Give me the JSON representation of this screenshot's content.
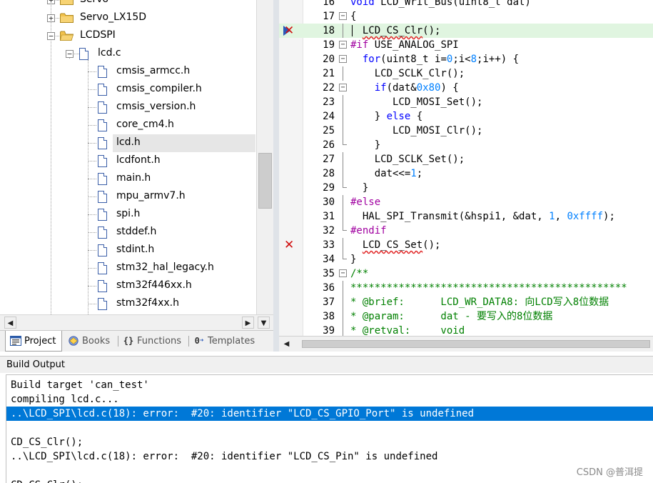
{
  "project_tree": {
    "items": [
      {
        "label": "Servo",
        "kind": "folder",
        "expander": "+"
      },
      {
        "label": "Servo_LX15D",
        "kind": "folder",
        "expander": "+"
      },
      {
        "label": "LCDSPI",
        "kind": "folder",
        "expander": "−"
      },
      {
        "label": "lcd.c",
        "kind": "file",
        "expander": "−"
      },
      {
        "label": "cmsis_armcc.h",
        "kind": "header"
      },
      {
        "label": "cmsis_compiler.h",
        "kind": "header"
      },
      {
        "label": "cmsis_version.h",
        "kind": "header"
      },
      {
        "label": "core_cm4.h",
        "kind": "header"
      },
      {
        "label": "lcd.h",
        "kind": "header",
        "selected": true
      },
      {
        "label": "lcdfont.h",
        "kind": "header"
      },
      {
        "label": "main.h",
        "kind": "header"
      },
      {
        "label": "mpu_armv7.h",
        "kind": "header"
      },
      {
        "label": "spi.h",
        "kind": "header"
      },
      {
        "label": "stddef.h",
        "kind": "header"
      },
      {
        "label": "stdint.h",
        "kind": "header"
      },
      {
        "label": "stm32_hal_legacy.h",
        "kind": "header"
      },
      {
        "label": "stm32f446xx.h",
        "kind": "header"
      },
      {
        "label": "stm32f4xx.h",
        "kind": "header"
      }
    ]
  },
  "scrollbar": {
    "left": "◀",
    "right": "▶",
    "down": "▼"
  },
  "tabs": [
    {
      "label": "Project",
      "icon": "project-icon",
      "active": true
    },
    {
      "label": "Books",
      "icon": "books-icon"
    },
    {
      "label": "Functions",
      "icon": "functions-icon",
      "glyph": "{}"
    },
    {
      "label": "Templates",
      "icon": "templates-icon",
      "glyph": "0"
    }
  ],
  "editor": {
    "lines": [
      {
        "n": "16",
        "fold": "none",
        "html": "<span class=\"kw\">void</span> LCD_Writ_Bus(uint8_t dat)"
      },
      {
        "n": "17",
        "fold": "open",
        "html": "{"
      },
      {
        "n": "18",
        "fold": "line",
        "mark": "arrow-error",
        "current": true,
        "html": "  <span class=\"squiggle\">LCD_CS_Clr</span>();"
      },
      {
        "n": "19",
        "fold": "open",
        "html": "<span class=\"pp\">#if</span> USE_ANALOG_SPI"
      },
      {
        "n": "20",
        "fold": "open",
        "html": "  <span class=\"kw\">for</span>(uint8_t i=<span class=\"num\">0</span>;i&lt;<span class=\"num\">8</span>;i++) {"
      },
      {
        "n": "21",
        "fold": "line",
        "html": "    LCD_SCLK_Clr();"
      },
      {
        "n": "22",
        "fold": "open",
        "html": "    <span class=\"kw\">if</span>(dat&amp;<span class=\"num\">0x80</span>) {"
      },
      {
        "n": "23",
        "fold": "line",
        "html": "       LCD_MOSI_Set();"
      },
      {
        "n": "24",
        "fold": "line",
        "html": "    } <span class=\"kw\">else</span> {"
      },
      {
        "n": "25",
        "fold": "line",
        "html": "       LCD_MOSI_Clr();"
      },
      {
        "n": "26",
        "fold": "end",
        "html": "    }"
      },
      {
        "n": "27",
        "fold": "line",
        "html": "    LCD_SCLK_Set();"
      },
      {
        "n": "28",
        "fold": "line",
        "html": "    dat&lt;&lt;=<span class=\"num\">1</span>;"
      },
      {
        "n": "29",
        "fold": "end",
        "html": "  }"
      },
      {
        "n": "30",
        "fold": "line",
        "html": "<span class=\"pp\">#else</span>"
      },
      {
        "n": "31",
        "fold": "line",
        "html": "  HAL_SPI_Transmit(&amp;hspi1, &amp;dat, <span class=\"num\">1</span>, <span class=\"num\">0xffff</span>);"
      },
      {
        "n": "32",
        "fold": "end",
        "html": "<span class=\"pp\">#endif</span>"
      },
      {
        "n": "33",
        "fold": "line",
        "mark": "error",
        "html": "  <span class=\"squiggle\">LCD_CS_Set</span>();"
      },
      {
        "n": "34",
        "fold": "end",
        "html": "}"
      },
      {
        "n": "35",
        "fold": "open",
        "html": "<span class=\"cmt\">/**</span>"
      },
      {
        "n": "36",
        "fold": "line",
        "html": "<span class=\"cmt\">**********************************************</span>"
      },
      {
        "n": "37",
        "fold": "line",
        "html": "<span class=\"cmt\">* @brief:      LCD_WR_DATA8: 向LCD写入8位数据</span>"
      },
      {
        "n": "38",
        "fold": "line",
        "html": "<span class=\"cmt\">* @param:      dat - 要写入的8位数据</span>"
      },
      {
        "n": "39",
        "fold": "line",
        "html": "<span class=\"cmt\">* @retval:     void</span>"
      }
    ]
  },
  "build_output": {
    "title": "Build Output",
    "lines": [
      {
        "text": "Build target 'can_test'"
      },
      {
        "text": "compiling lcd.c..."
      },
      {
        "text": "..\\LCD_SPI\\lcd.c(18): error:  #20: identifier \"LCD_CS_GPIO_Port\" is undefined",
        "selected": true
      },
      {
        "text": ""
      },
      {
        "text": "CD_CS_Clr();"
      },
      {
        "text": "..\\LCD_SPI\\lcd.c(18): error:  #20: identifier \"LCD_CS_Pin\" is undefined"
      },
      {
        "text": ""
      },
      {
        "text": "CD_CS_Clr();"
      }
    ]
  },
  "watermark": "CSDN @普洱提"
}
